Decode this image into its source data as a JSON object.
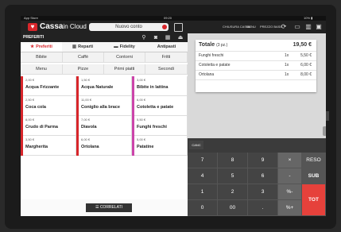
{
  "status_bar": {
    "carrier": "App Store",
    "time": "09:20",
    "battery": "10% ▮"
  },
  "header": {
    "brand_bold": "Cassa",
    "brand_light": "in Cloud",
    "account_select": "Nuovo conto",
    "actions": [
      "CHIUSURA CASSA",
      "MENU",
      "PREZZO BASE"
    ]
  },
  "subbar": {
    "title": "PREFERITI"
  },
  "tabs": [
    {
      "label": "Preferiti",
      "icon": "★"
    },
    {
      "label": "Reparti",
      "icon": "▥"
    },
    {
      "label": "Fidelity",
      "icon": "▬"
    },
    {
      "label": "Antipasti",
      "icon": ""
    }
  ],
  "categories": [
    [
      "Bibite",
      "Caffè",
      "Contorni",
      "Fritti"
    ],
    [
      "Menu",
      "Pizze",
      "Primi piatti",
      "Secondi"
    ]
  ],
  "products": [
    [
      {
        "price": "2,00 €",
        "name": "Acqua Frizzante",
        "color": "#d8262b"
      },
      {
        "price": "1,50 €",
        "name": "Acqua Naturale",
        "color": "#d8262b"
      },
      {
        "price": "3,00 €",
        "name": "Bibite in lattina",
        "color": "#cc44aa"
      }
    ],
    [
      {
        "price": "2,50 €",
        "name": "Coca cola",
        "color": "#d8262b"
      },
      {
        "price": "11,00 €",
        "name": "Coniglio alla brace",
        "color": "#d8262b"
      },
      {
        "price": "6,00 €",
        "name": "Cotoletta e patate",
        "color": "#cc44aa"
      }
    ],
    [
      {
        "price": "8,00 €",
        "name": "Crudo di Parma",
        "color": "#d8262b"
      },
      {
        "price": "7,00 €",
        "name": "Diavola",
        "color": "#d8262b"
      },
      {
        "price": "5,50 €",
        "name": "Funghi freschi",
        "color": "#cc44aa"
      }
    ],
    [
      {
        "price": "3,50 €",
        "name": "Margherita",
        "color": "#d8262b"
      },
      {
        "price": "6,00 €",
        "name": "Ortolana",
        "color": "#d8262b"
      },
      {
        "price": "5,00 €",
        "name": "Patatine",
        "color": "#cc44aa"
      }
    ]
  ],
  "related_button": "CORRELATI",
  "ticket": {
    "total_label": "Totale",
    "total_count": "(3 pz.)",
    "total_value": "19,50 €",
    "rows": [
      {
        "name": "Funghi freschi",
        "qty": "1x",
        "price": "5,50 €"
      },
      {
        "name": "Cotoletta e patate",
        "qty": "1x",
        "price": "6,00 €"
      },
      {
        "name": "Ortolana",
        "qty": "1x",
        "price": "8,00 €"
      }
    ]
  },
  "keypad": {
    "cancel": "CANC",
    "digits": [
      "7",
      "8",
      "9",
      "4",
      "5",
      "6",
      "1",
      "2",
      "3",
      "0",
      "00",
      "."
    ],
    "ops": [
      "×",
      "-",
      "%-",
      "%+"
    ],
    "actions": [
      "RESO",
      "SUB",
      "TOT"
    ]
  },
  "colors": {
    "accent": "#d8262b",
    "total_button": "#e6413b"
  }
}
